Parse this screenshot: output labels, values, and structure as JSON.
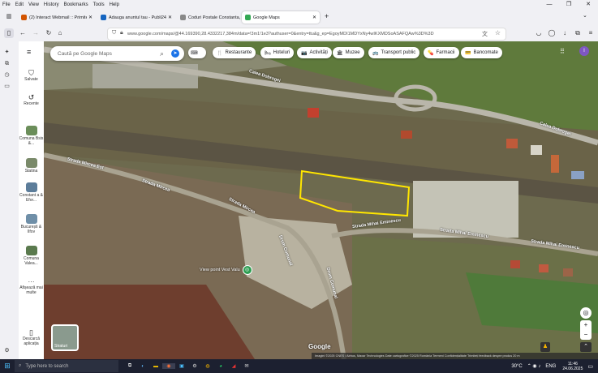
{
  "menubar": [
    "File",
    "Edit",
    "View",
    "History",
    "Bookmarks",
    "Tools",
    "Help"
  ],
  "window_controls": [
    "—",
    "❐",
    "✕"
  ],
  "tabs": [
    {
      "title": "(2) Interact Webmail :: Primite",
      "favicon_color": "#d35400"
    },
    {
      "title": "Adauga anuntul tau - Publi24",
      "favicon_color": "#1565c0"
    },
    {
      "title": "Coduri Postale Constanta, Constan",
      "favicon_color": "#888888"
    },
    {
      "title": "Google Maps",
      "favicon_color": "#34a853",
      "active": true
    }
  ],
  "new_tab": "+",
  "url": "www.google.com/maps/@44.169390,28.4332217,384m/data=!3m1!1e3?authuser=0&entry=ttu&g_ep=EgoyMDI1MDYxNy4wIKXMDSoASAFQAw%3D%3D",
  "left_panel": [
    {
      "label": "Salvate",
      "icon": "bookmark-icon"
    },
    {
      "label": "Recente",
      "icon": "history-icon"
    },
    {
      "label": "Comuna Bsis &...",
      "icon": "thumb"
    },
    {
      "label": "Statina",
      "icon": "thumb"
    },
    {
      "label": "Constant a & Efor...",
      "icon": "thumb"
    },
    {
      "label": "București & Ilfov",
      "icon": "thumb"
    },
    {
      "label": "Comuna Valea...",
      "icon": "thumb"
    },
    {
      "label": "Afișează mai multe",
      "icon": "more"
    },
    {
      "label": "Descarcă aplicația",
      "icon": "phone-icon"
    }
  ],
  "search": {
    "placeholder": "Caută pe Google Maps"
  },
  "chips": [
    {
      "label": "Restaurante",
      "icon": "🍴"
    },
    {
      "label": "Hoteluri",
      "icon": "🛏"
    },
    {
      "label": "Activități",
      "icon": "📷"
    },
    {
      "label": "Muzee",
      "icon": "🏛"
    },
    {
      "label": "Transport public",
      "icon": "🚌"
    },
    {
      "label": "Farmacii",
      "icon": "💊"
    },
    {
      "label": "Bancomate",
      "icon": "💳"
    }
  ],
  "streets": [
    "Calea Dobrogei",
    "Calea Dobrogei",
    "Strada Mircea Est",
    "Strada Mircea",
    "Strada Mircea",
    "Strada Mihai Eminescu",
    "Strada Mihai Eminescu",
    "Strada Mihai Eminescu",
    "Drum Comunal",
    "Drum Comunal"
  ],
  "poi": {
    "label": "View point Vest Valu"
  },
  "layer_button": {
    "label": "Straturi"
  },
  "google_logo": "Google",
  "attribution": "Imagini ©2025 CNES / Airbus, Maxar Technologies Date cartografice ©2025   România   Termeni   Confidențialitate   Trimiteți feedback despre produs   20 m",
  "taskbar": {
    "search_placeholder": "Type here to search",
    "weather": "30°C",
    "lang": "ENG",
    "time": "11:46",
    "date": "24.06.2025"
  },
  "colors": {
    "accent": "#1a73e8",
    "selection_outline": "#ffe600",
    "avatar": "#7e57c2"
  }
}
